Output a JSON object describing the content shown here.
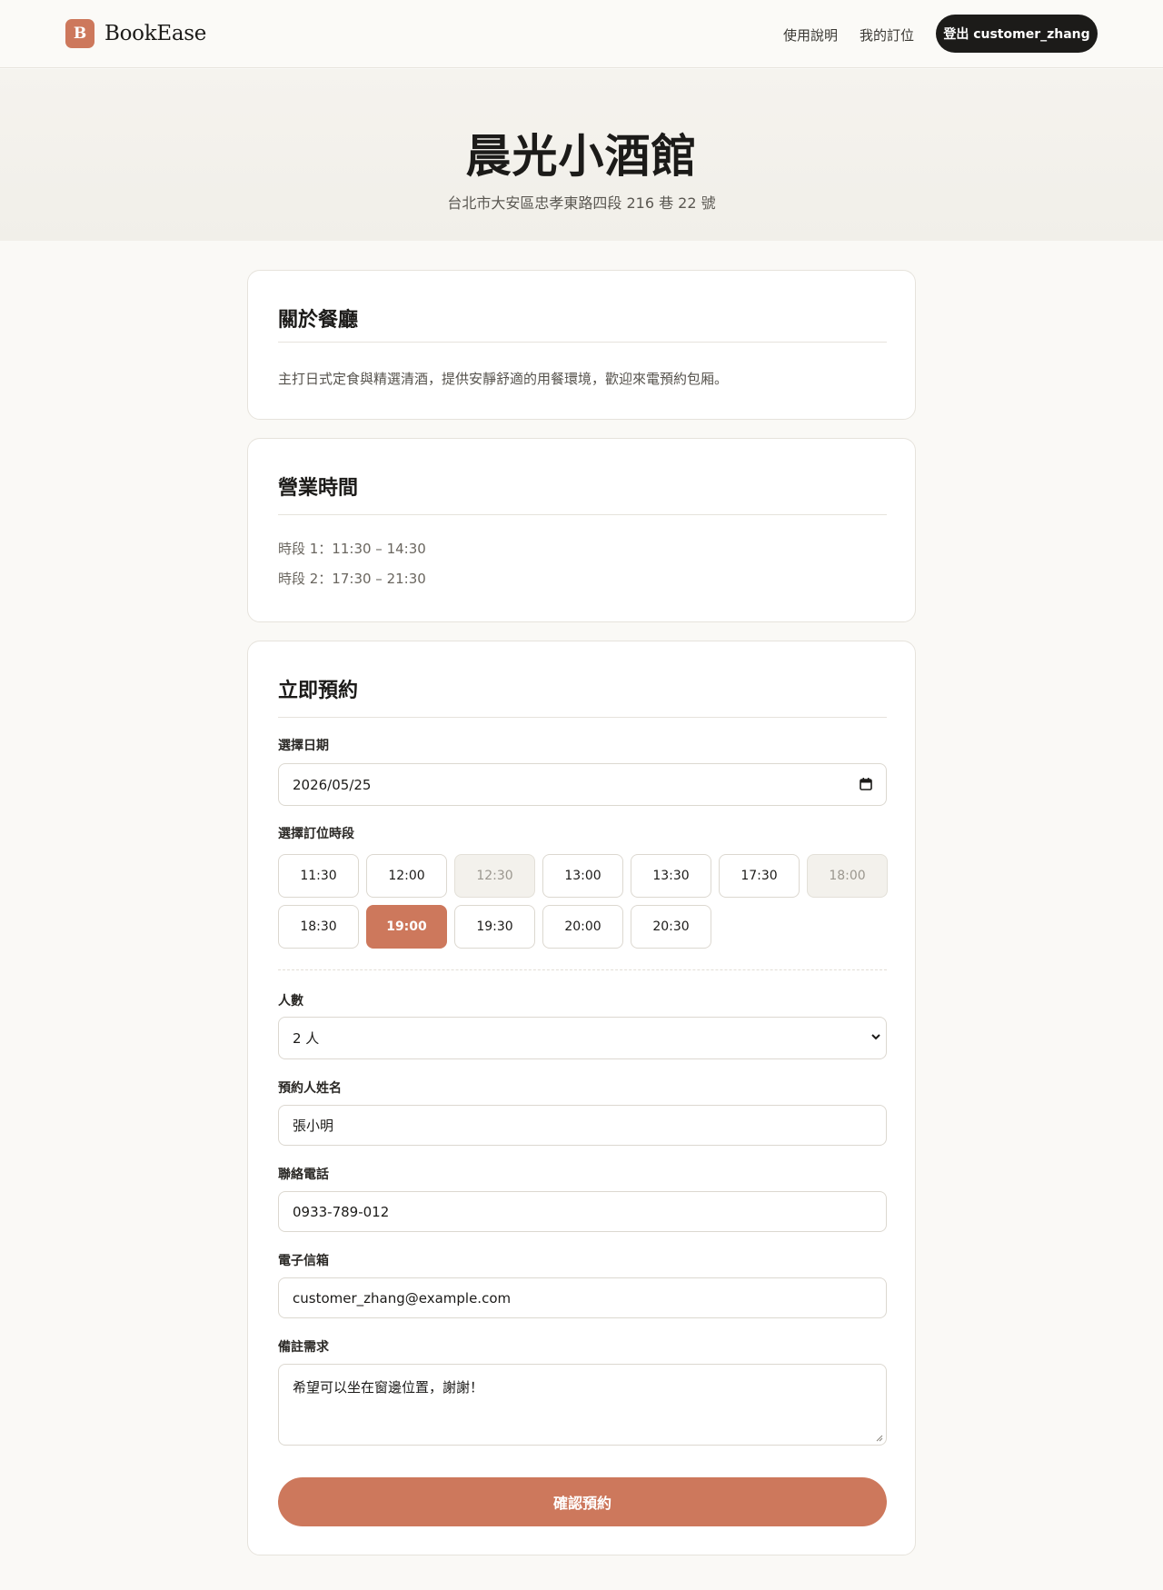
{
  "header": {
    "logo_letter": "B",
    "brand_name": "BookEase",
    "nav": {
      "help": "使用說明",
      "my_bookings": "我的訂位"
    },
    "logout_label": "登出 customer_zhang"
  },
  "hero": {
    "title": "晨光小酒館",
    "address": "台北市大安區忠孝東路四段 216 巷 22 號"
  },
  "about": {
    "title": "關於餐廳",
    "text": "主打日式定食與精選清酒，提供安靜舒適的用餐環境，歡迎來電預約包厢。"
  },
  "hours": {
    "title": "營業時間",
    "periods": [
      "時段 1：11:30 – 14:30",
      "時段 2：17:30 – 21:30"
    ]
  },
  "booking": {
    "title": "立即預約",
    "date_label": "選擇日期",
    "date_value": "2026/05/25",
    "slot_label": "選擇訂位時段",
    "slots": [
      {
        "time": "11:30",
        "state": "available"
      },
      {
        "time": "12:00",
        "state": "available"
      },
      {
        "time": "12:30",
        "state": "disabled"
      },
      {
        "time": "13:00",
        "state": "available"
      },
      {
        "time": "13:30",
        "state": "available"
      },
      {
        "time": "17:30",
        "state": "available"
      },
      {
        "time": "18:00",
        "state": "disabled"
      },
      {
        "time": "18:30",
        "state": "available"
      },
      {
        "time": "19:00",
        "state": "selected"
      },
      {
        "time": "19:30",
        "state": "available"
      },
      {
        "time": "20:00",
        "state": "available"
      },
      {
        "time": "20:30",
        "state": "available"
      }
    ],
    "party_label": "人數",
    "party_value": "2 人",
    "name_label": "預約人姓名",
    "name_value": "張小明",
    "phone_label": "聯絡電話",
    "phone_value": "0933-789-012",
    "email_label": "電子信箱",
    "email_value": "customer_zhang@example.com",
    "notes_label": "備註需求",
    "notes_value": "希望可以坐在窗邊位置，謝謝！",
    "submit_label": "確認預約"
  },
  "colors": {
    "accent": "#cd785c",
    "dark": "#1c1b19",
    "page_bg": "#faf9f6"
  },
  "icons": [
    "calendar-icon",
    "chevron-down-icon",
    "resize-handle-icon"
  ]
}
